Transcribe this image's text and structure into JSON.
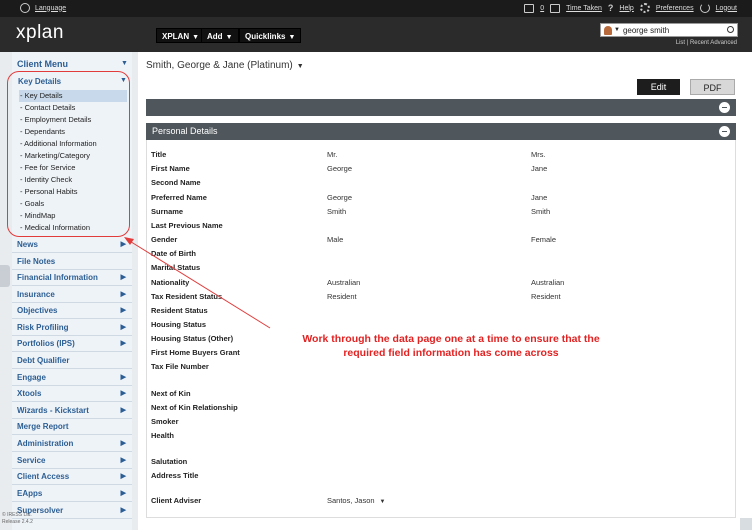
{
  "topbar": {
    "language": "Language",
    "mail_count": "0",
    "time_taken": "Time Taken",
    "help": "Help",
    "preferences": "Preferences",
    "logout": "Logout"
  },
  "header": {
    "logo": "xplan",
    "nav": [
      "XPLAN",
      "Add",
      "Quicklinks"
    ],
    "search_value": "george smith",
    "search_links": "List | Recent  Advanced"
  },
  "sidebar": {
    "client_menu": "Client Menu",
    "key_details": "Key Details",
    "sub_items": [
      "- Key Details",
      "- Contact Details",
      "- Employment Details",
      "- Dependants",
      "- Additional Information",
      "- Marketing/Category",
      "- Fee for Service",
      "- Identity Check",
      "- Personal Habits",
      "- Goals",
      "- MindMap",
      "- Medical Information"
    ],
    "items": [
      "News",
      "File Notes",
      "Financial Information",
      "Insurance",
      "Objectives",
      "Risk Profiling",
      "Portfolios (IPS)",
      "Debt Qualifier",
      "Engage",
      "Xtools",
      "Wizards - Kickstart",
      "Merge Report",
      "Administration",
      "Service",
      "Client Access",
      "EApps",
      "Supersolver"
    ],
    "footer": [
      "© IRESS Ltd.",
      "Release 2.4.2"
    ]
  },
  "main": {
    "client_name": "Smith, George & Jane (Platinum)",
    "edit": "Edit",
    "pdf": "PDF",
    "section_title": "Personal Details",
    "rows": [
      {
        "label": "Title",
        "v1": "Mr.",
        "v2": "Mrs."
      },
      {
        "label": "First Name",
        "v1": "George",
        "v2": "Jane"
      },
      {
        "label": "Second Name",
        "v1": "",
        "v2": ""
      },
      {
        "label": "Preferred Name",
        "v1": "George",
        "v2": "Jane"
      },
      {
        "label": "Surname",
        "v1": "Smith",
        "v2": "Smith"
      },
      {
        "label": "Last Previous Name",
        "v1": "",
        "v2": ""
      },
      {
        "label": "Gender",
        "v1": "Male",
        "v2": "Female"
      },
      {
        "label": "Date of Birth",
        "v1": "",
        "v2": ""
      },
      {
        "label": "Marital Status",
        "v1": "",
        "v2": ""
      },
      {
        "label": "Nationality",
        "v1": "Australian",
        "v2": "Australian"
      },
      {
        "label": "Tax Resident Status",
        "v1": "Resident",
        "v2": "Resident"
      },
      {
        "label": "Resident Status",
        "v1": "",
        "v2": ""
      },
      {
        "label": "Housing Status",
        "v1": "",
        "v2": ""
      },
      {
        "label": "Housing Status (Other)",
        "v1": "",
        "v2": ""
      },
      {
        "label": "First Home Buyers Grant",
        "v1": "",
        "v2": ""
      },
      {
        "label": "Tax File Number",
        "v1": "",
        "v2": ""
      },
      {
        "label": "Next of Kin",
        "v1": "",
        "v2": ""
      },
      {
        "label": "Next of Kin Relationship",
        "v1": "",
        "v2": ""
      },
      {
        "label": "Smoker",
        "v1": "",
        "v2": ""
      },
      {
        "label": "Health",
        "v1": "",
        "v2": ""
      },
      {
        "label": "Salutation",
        "v1": "",
        "v2": ""
      },
      {
        "label": "Address Title",
        "v1": "",
        "v2": ""
      },
      {
        "label": "Client Adviser",
        "v1": "Santos, Jason",
        "v2": ""
      }
    ]
  },
  "annotation": {
    "line1": "Work through the data page one at a time to ensure that the",
    "line2": "required field information has come across",
    "color": "#e32222"
  }
}
